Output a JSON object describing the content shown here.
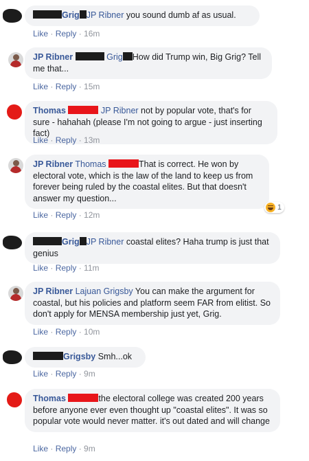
{
  "actions": {
    "like": "Like",
    "reply": "Reply",
    "sep": " · "
  },
  "comments": [
    {
      "name": "Grig",
      "tag": "JP Ribner",
      "text": " you sound dumb af as usual.",
      "time": "16m"
    },
    {
      "name": "JP Ribner",
      "tag": "Grig",
      "text": "How did Trump win, Big Grig? Tell me that...",
      "time": "15m"
    },
    {
      "name": "Thomas",
      "tag": "JP Ribner",
      "text": " not by popular vote, that's for sure - hahahah (please I'm not going to argue - just inserting fact)",
      "time": "13m"
    },
    {
      "name": "JP Ribner",
      "tag": "Thomas",
      "text": "That is correct. He won by electoral vote, which is the law of the land to keep us from forever being ruled by the coastal elites. But that doesn't answer my question...",
      "time": "12m",
      "reaction_count": "1",
      "reaction_icon": "haha-emoji-icon"
    },
    {
      "name": "Grig",
      "tag": "JP Ribner",
      "text": " coastal elites? Haha trump is just that genius",
      "time": "11m"
    },
    {
      "name": "JP Ribner",
      "tag": "Lajuan Grigsby",
      "text": " You can make the argument for coastal, but his policies and platform seem FAR from elitist. So don't apply for MENSA membership just yet, Grig.",
      "time": "10m"
    },
    {
      "name": "Grigsby",
      "text": " Smh...ok",
      "time": "9m"
    },
    {
      "name": "Thomas",
      "text": "the electoral college was created 200 years before anyone ever even thought up \"coastal elites\". It was so popular vote would never matter. it's out dated and will change",
      "time": "9m"
    }
  ],
  "colors": {
    "bubble": "#f2f3f5",
    "name": "#385898",
    "meta": "#90949c",
    "redaction_red": "#e8151a",
    "redaction_black": "#1c1c1c"
  }
}
